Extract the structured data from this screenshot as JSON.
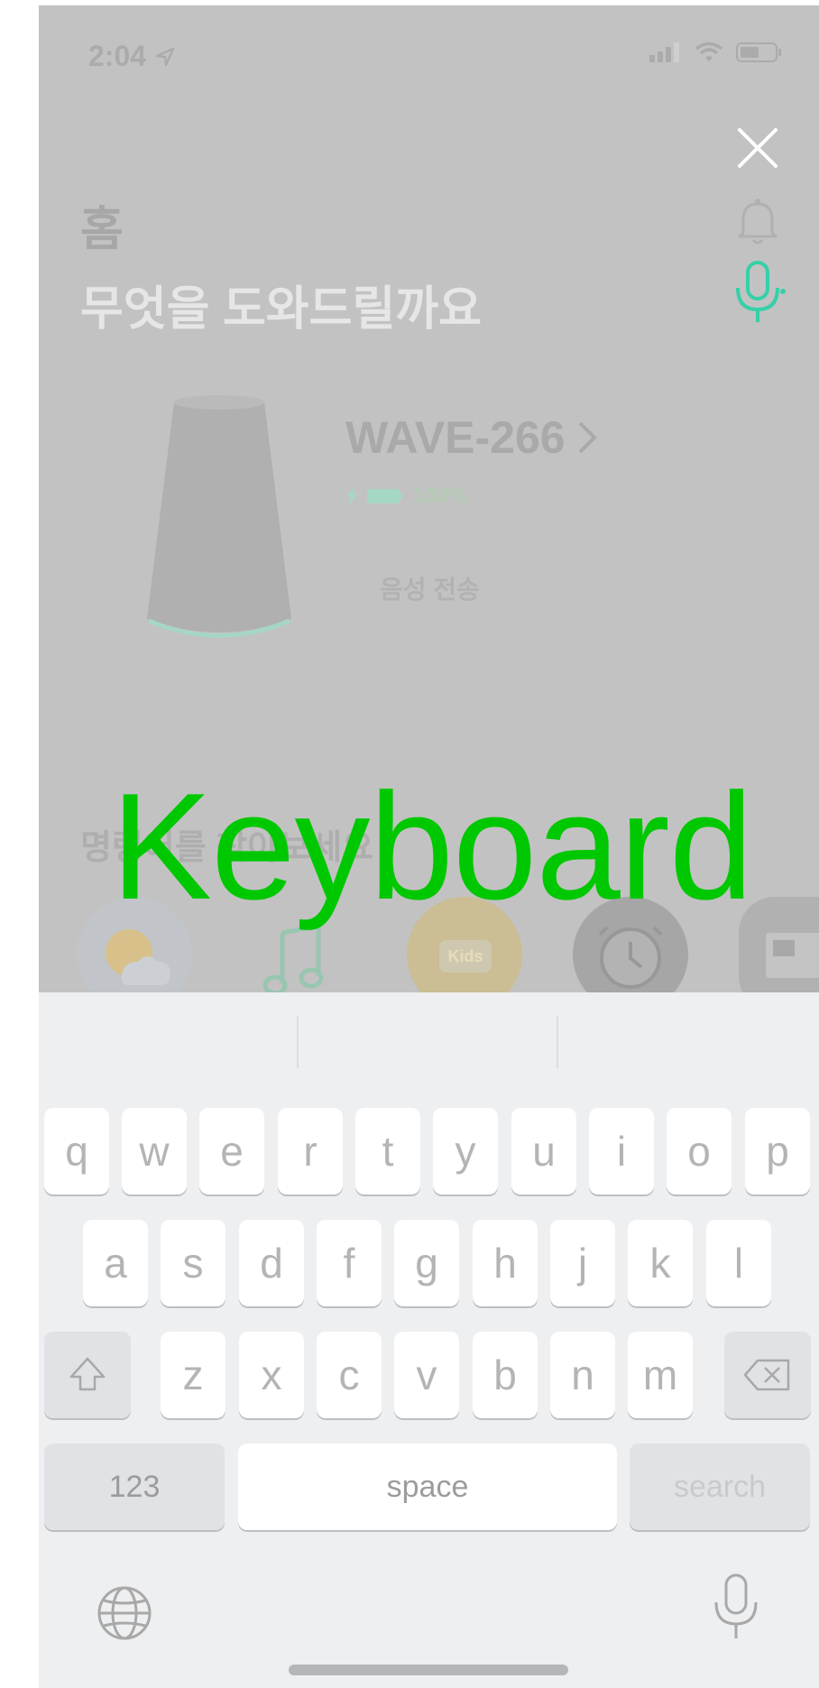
{
  "status_bar": {
    "time": "2:04"
  },
  "header": {
    "title": "홈",
    "subtitle": "무엇을 도와드릴까요"
  },
  "device": {
    "name": "WAVE-266",
    "battery": "100%",
    "voice_send": "음성 전송"
  },
  "commands": {
    "title": "명령어를 찾아보세요",
    "tiles": [
      {
        "icon": "weather-icon",
        "label": ""
      },
      {
        "icon": "music-icon",
        "label": ""
      },
      {
        "icon": "kids-icon",
        "label": "Kids"
      },
      {
        "icon": "alarm-icon",
        "label": ""
      },
      {
        "icon": "news-icon",
        "label": ""
      }
    ]
  },
  "overlay": {
    "label": "Keyboard",
    "color": "#00c800"
  },
  "keyboard": {
    "rows": [
      [
        "q",
        "w",
        "e",
        "r",
        "t",
        "y",
        "u",
        "i",
        "o",
        "p"
      ],
      [
        "a",
        "s",
        "d",
        "f",
        "g",
        "h",
        "j",
        "k",
        "l"
      ],
      [
        "z",
        "x",
        "c",
        "v",
        "b",
        "n",
        "m"
      ]
    ],
    "numbers_label": "123",
    "space_label": "space",
    "return_label": "search"
  },
  "colors": {
    "accent": "#35d0a8",
    "overlay_text": "#00c800",
    "keyboard_bg": "#eeeff1"
  }
}
